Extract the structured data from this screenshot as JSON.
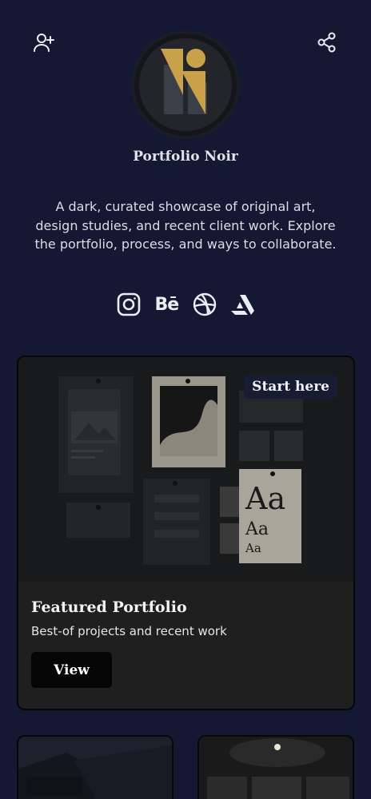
{
  "header": {
    "add_follow_icon": "user-plus-icon",
    "share_icon": "share-icon"
  },
  "profile": {
    "name": "Portfolio Noir",
    "bio": "A dark, curated showcase of original art, design studies, and recent client work. Explore the portfolio, process, and ways to collaborate.",
    "logo_colors": {
      "gold": "#c9a14a",
      "slate": "#3b3f47"
    }
  },
  "socials": [
    {
      "icon": "instagram-icon"
    },
    {
      "icon": "behance-icon",
      "text": "Bē"
    },
    {
      "icon": "dribbble-icon"
    },
    {
      "icon": "artstation-icon"
    }
  ],
  "featured": {
    "badge": "Start here",
    "title": "Featured Portfolio",
    "subtitle": "Best-of projects and recent work",
    "button": "View"
  },
  "colors": {
    "background": "#151833",
    "card": "#1f1f20",
    "badge_bg": "#181c33",
    "button_bg": "#050506"
  }
}
